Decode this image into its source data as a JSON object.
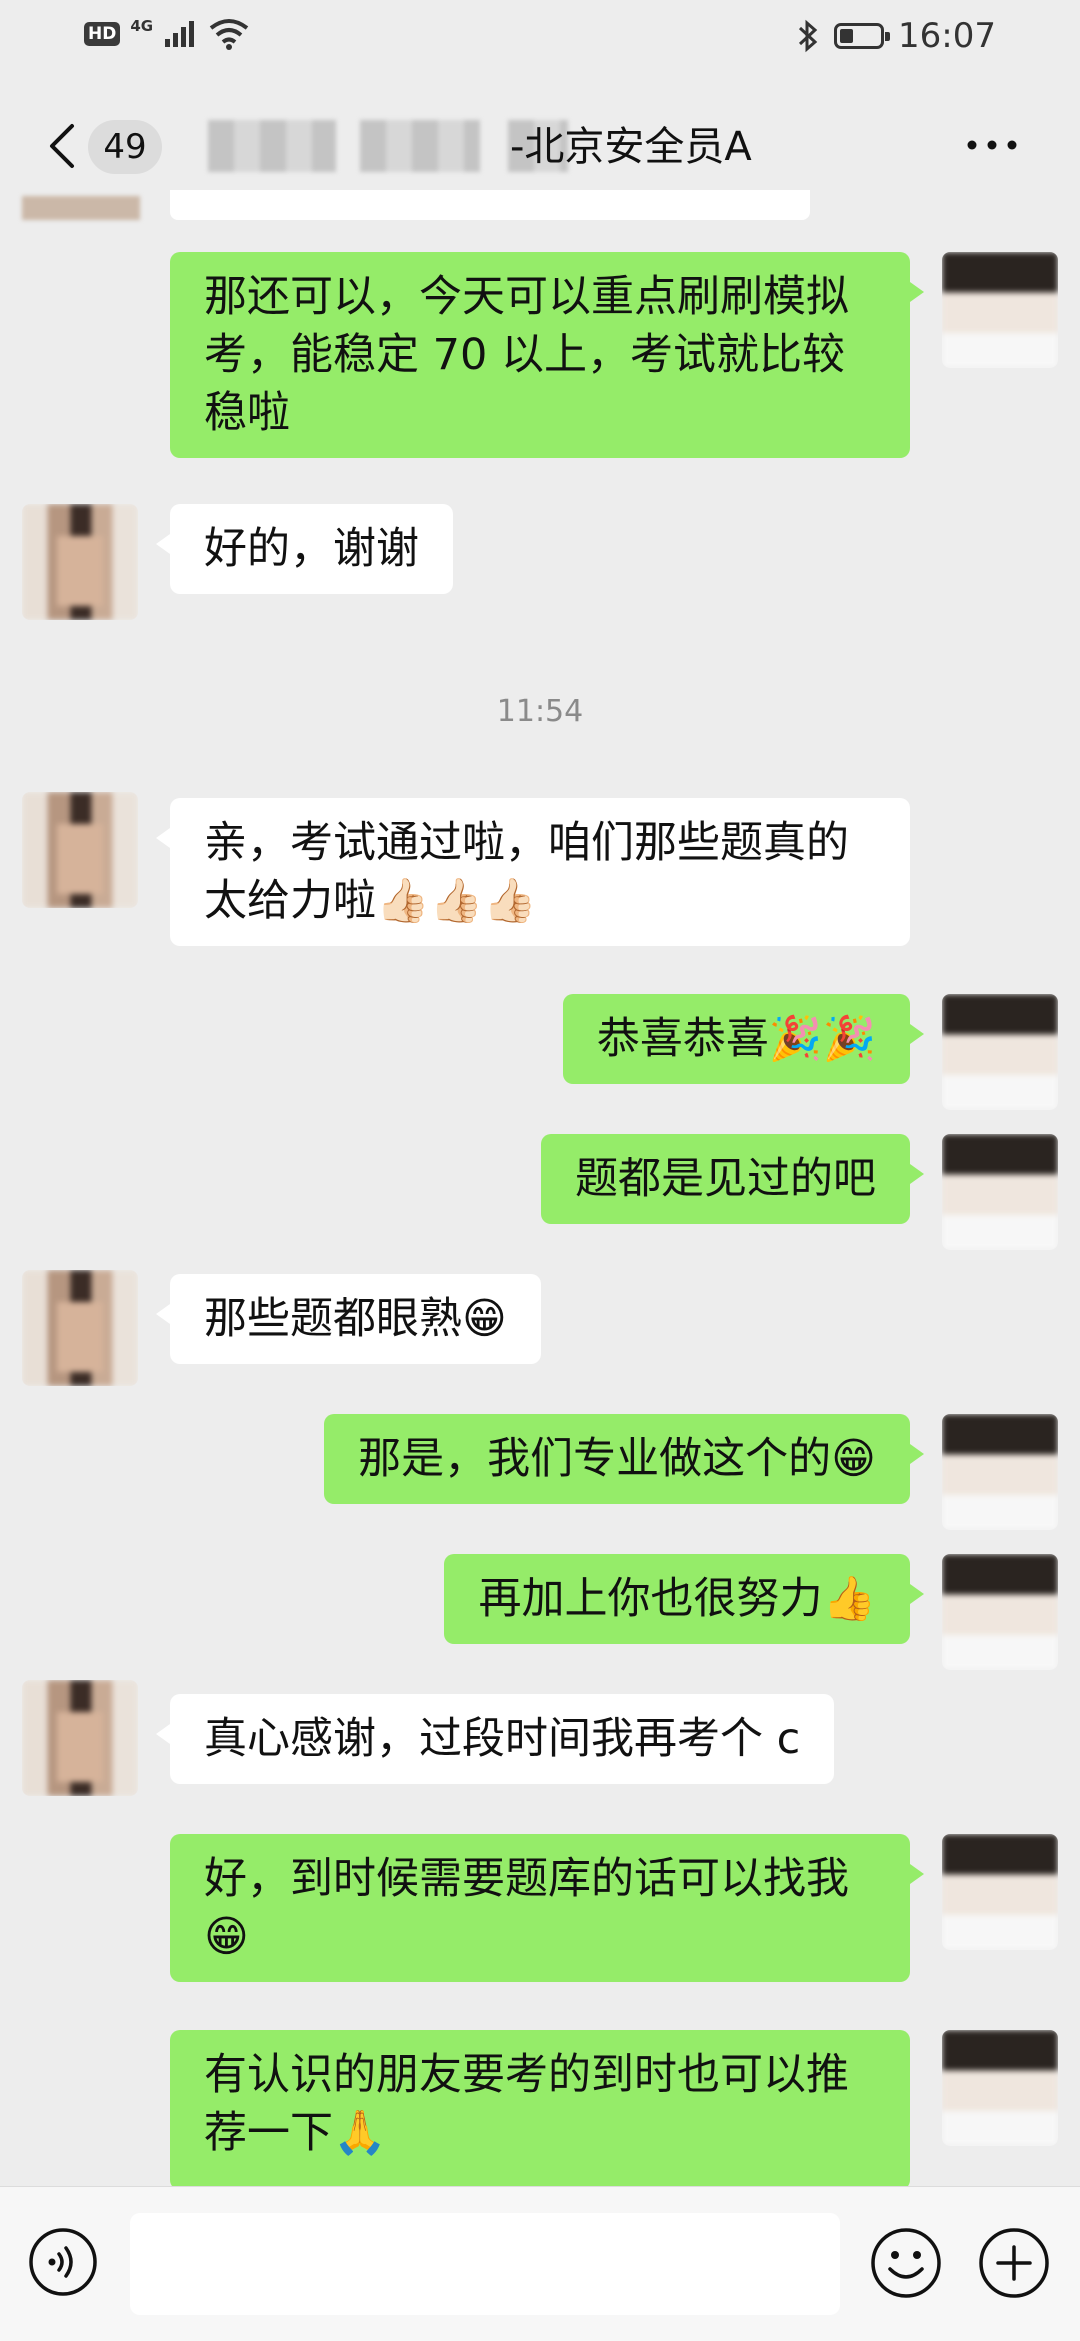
{
  "status_bar": {
    "hd_badge": "HD",
    "network": "4G",
    "time": "16:07",
    "battery_level": 0.35
  },
  "header": {
    "unread_count": "49",
    "title": "-北京安全员A"
  },
  "timestamp": "11:54",
  "messages": [
    {
      "from": "me",
      "text": "那还可以，今天可以重点刷刷模拟考，能稳定 70 以上，考试就比较稳啦"
    },
    {
      "from": "them",
      "text": "好的，谢谢"
    },
    {
      "from": "them",
      "text": "亲，考试通过啦，咱们那些题真的太给力啦👍🏻👍🏻👍🏻"
    },
    {
      "from": "me",
      "text": "恭喜恭喜🎉🎉"
    },
    {
      "from": "me",
      "text": "题都是见过的吧"
    },
    {
      "from": "them",
      "text": "那些题都眼熟😁"
    },
    {
      "from": "me",
      "text": "那是，我们专业做这个的😁"
    },
    {
      "from": "me",
      "text": "再加上你也很努力👍"
    },
    {
      "from": "them",
      "text": "真心感谢，过段时间我再考个 c"
    },
    {
      "from": "me",
      "text": "好，到时候需要题库的话可以找我😁"
    },
    {
      "from": "me",
      "text": "有认识的朋友要考的到时也可以推荐一下🙏"
    }
  ],
  "input": {
    "value": "",
    "placeholder": ""
  }
}
